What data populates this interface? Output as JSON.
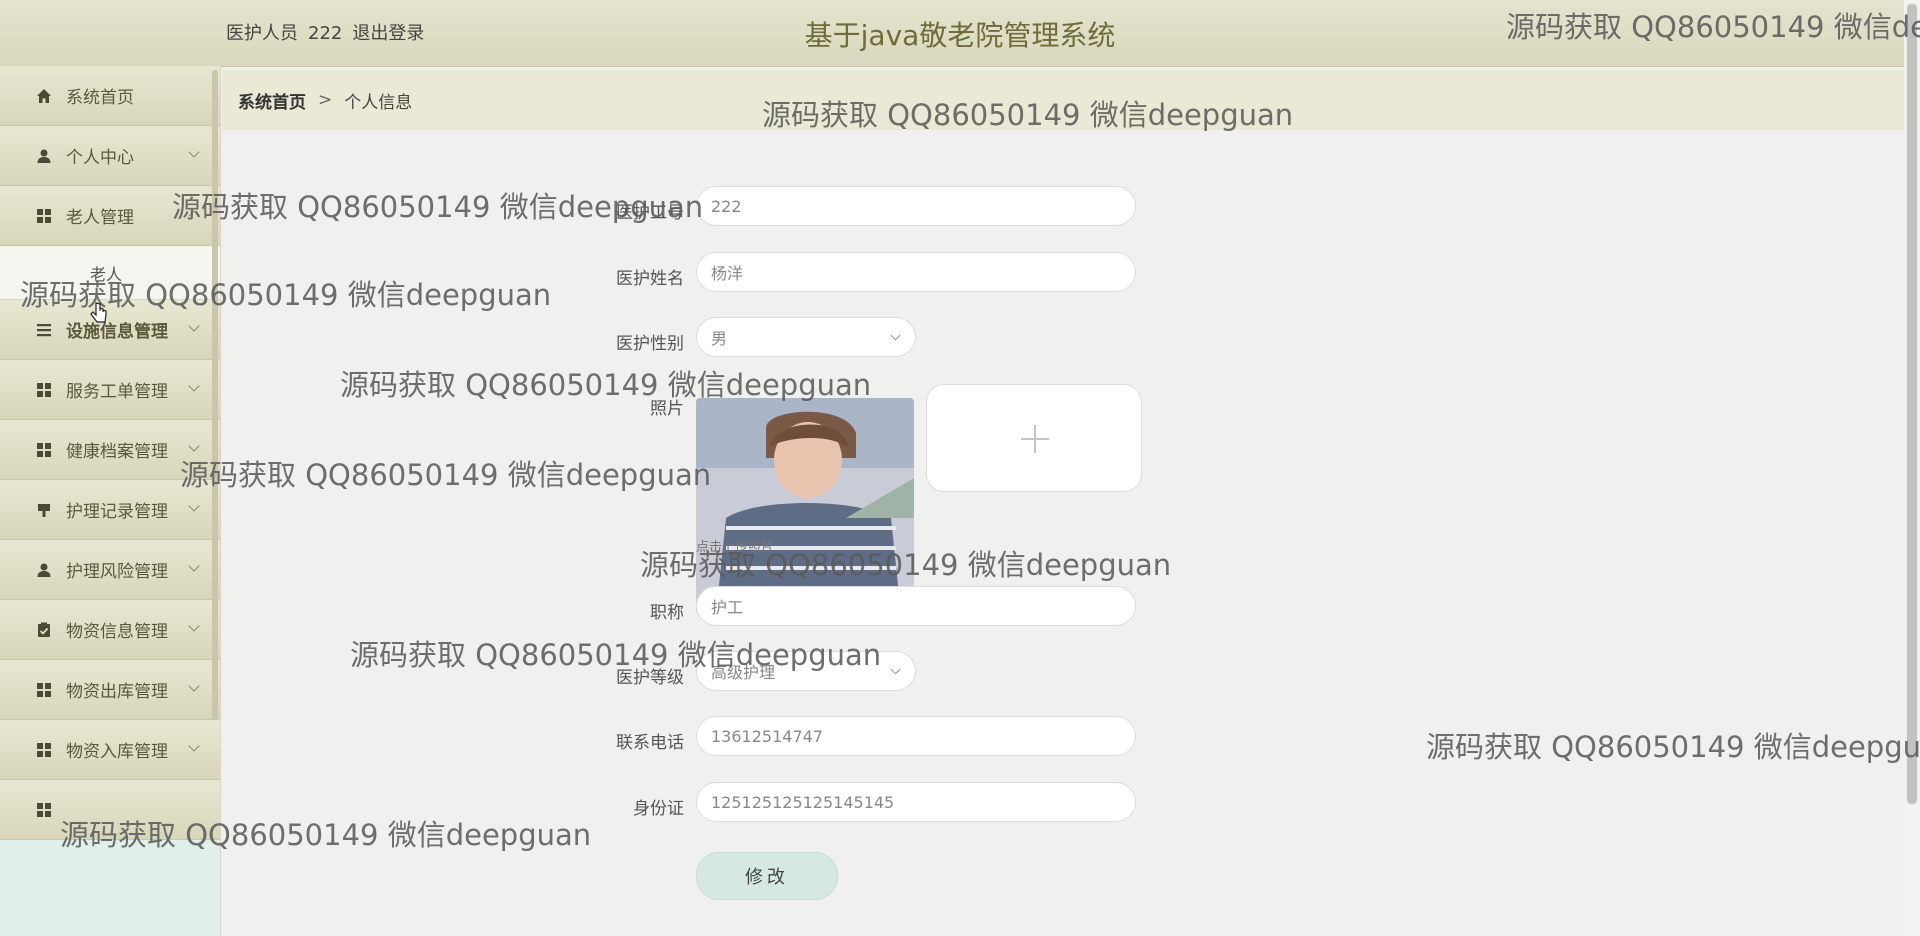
{
  "header": {
    "user_role": "医护人员",
    "user_name": "222",
    "logout_label": "退出登录",
    "system_title": "基于java敬老院管理系统"
  },
  "sidebar": {
    "items": [
      {
        "label": "系统首页",
        "icon": "home-icon"
      },
      {
        "label": "个人中心",
        "icon": "user-icon"
      },
      {
        "label": "老人管理",
        "icon": "grid-icon"
      },
      {
        "label": "老人",
        "icon": ""
      },
      {
        "label": "设施信息管理",
        "icon": "list-icon"
      },
      {
        "label": "服务工单管理",
        "icon": "grid-icon"
      },
      {
        "label": "健康档案管理",
        "icon": "grid-icon"
      },
      {
        "label": "护理记录管理",
        "icon": "flag-icon"
      },
      {
        "label": "护理风险管理",
        "icon": "user-icon"
      },
      {
        "label": "物资信息管理",
        "icon": "clipboard-check-icon"
      },
      {
        "label": "物资出库管理",
        "icon": "grid-icon"
      },
      {
        "label": "物资入库管理",
        "icon": "grid-icon"
      }
    ]
  },
  "breadcrumb": {
    "home": "系统首页",
    "separator": ">",
    "current": "个人信息"
  },
  "form": {
    "fields": {
      "gonghao": {
        "label": "医护工号",
        "value": "222"
      },
      "name": {
        "label": "医护姓名",
        "value": "杨洋"
      },
      "gender": {
        "label": "医护性别",
        "value": "男"
      },
      "photo": {
        "label": "照片",
        "hint": "点击上传照片"
      },
      "title": {
        "label": "职称",
        "value": "护工"
      },
      "level": {
        "label": "医护等级",
        "value": "高级护理"
      },
      "phone": {
        "label": "联系电话",
        "value": "13612514747"
      },
      "idcard": {
        "label": "身份证",
        "value": "125125125125145145"
      }
    },
    "submit_label": "修改"
  },
  "watermark_text": "源码获取 QQ86050149 微信deepguan",
  "colors": {
    "topbar": "#dedcc3",
    "title": "#706c3a",
    "sidebar_item": "#e0dfc6",
    "sidebar_bg": "#e0efe9",
    "button": "#d5e8e4"
  }
}
